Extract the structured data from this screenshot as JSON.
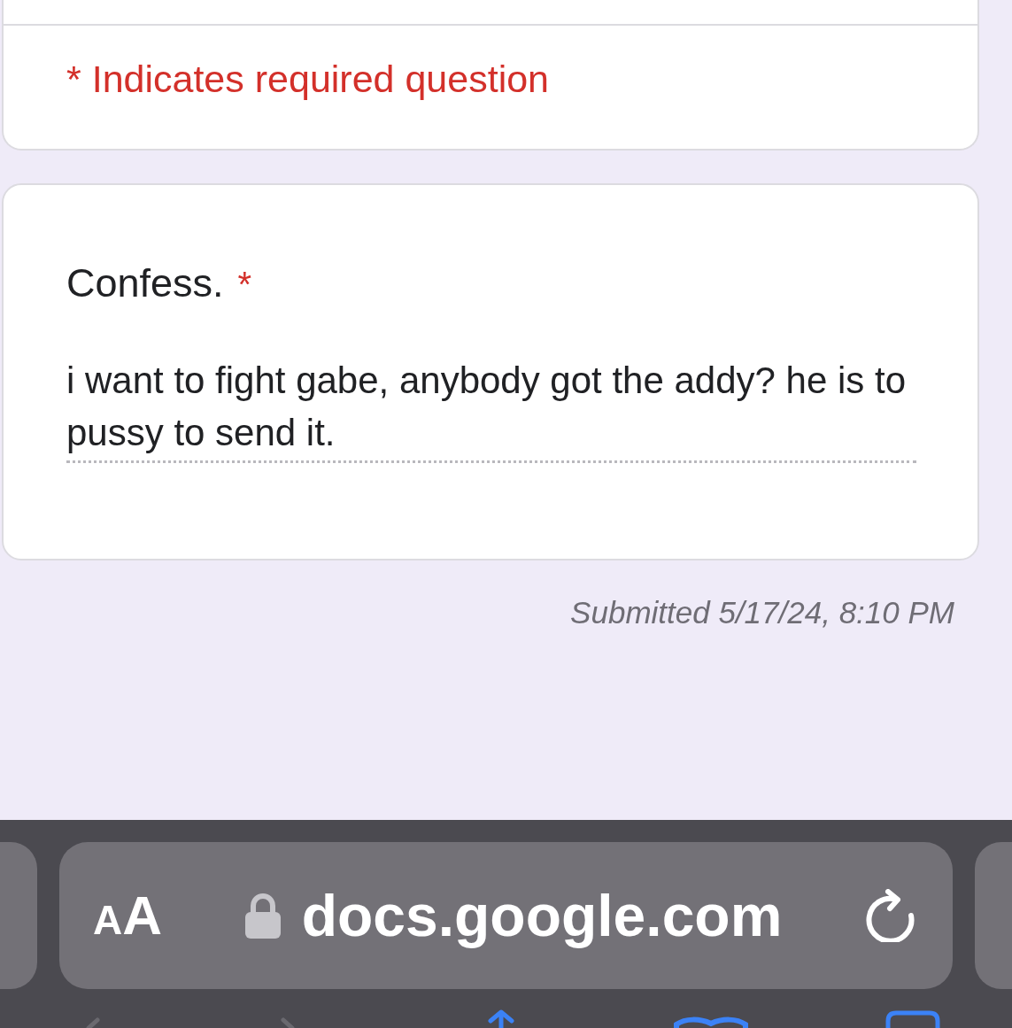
{
  "form_header": {
    "required_note": "* Indicates required question"
  },
  "question": {
    "title": "Confess.",
    "required_mark": "*",
    "answer": "i want to fight gabe, anybody got the addy? he is to pussy to send it."
  },
  "submitted": "Submitted 5/17/24, 8:10 PM",
  "browser_bar": {
    "text_size_button": "AA",
    "url": "docs.google.com"
  },
  "toolbar": [
    {
      "kind": "back",
      "disabled": true
    },
    {
      "kind": "forward",
      "disabled": true
    },
    {
      "kind": "share",
      "disabled": false
    },
    {
      "kind": "bookmarks",
      "disabled": false
    },
    {
      "kind": "tabs",
      "disabled": false
    }
  ]
}
